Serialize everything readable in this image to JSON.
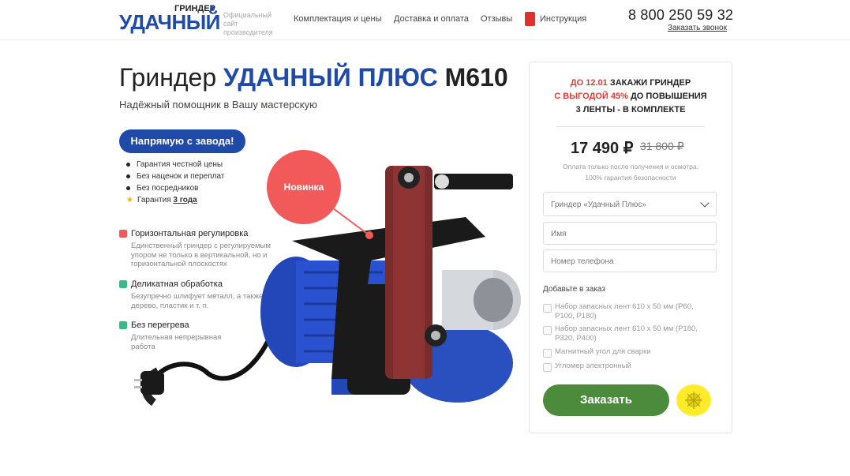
{
  "header": {
    "logo_top": "ГРИНДЕР",
    "logo_main": "УДАЧНЫЙ",
    "site_note": "Официальный сайт производителя",
    "nav": [
      "Комплектация и цены",
      "Доставка и оплата",
      "Отзывы",
      "Инструкция"
    ],
    "phone": "8 800 250 59 32",
    "callback": "Заказать звонок"
  },
  "hero": {
    "title_prefix": "Гриндер",
    "title_highlight": "УДАЧНЫЙ ПЛЮС",
    "title_model": "M610",
    "subtitle": "Надёжный помощник в Вашу мастерскую",
    "pill": "Напрямую с завода!",
    "bullets": [
      "Гарантия честной цены",
      "Без наценок и переплат",
      "Без посредников"
    ],
    "warranty_prefix": "Гарантия",
    "warranty_value": "3 года",
    "badge": "Новинка"
  },
  "features": [
    {
      "title": "Горизонтальная регулировка",
      "desc": "Единственный гриндер с регулируемым упором не только в вертикальной, но и горизонтальной плоскостях",
      "color": "#f25a5a"
    },
    {
      "title": "Деликатная обработка",
      "desc": "Безупречно шлифует металл, а также дерево, пластик и т. п.",
      "color": "#3ab98a"
    },
    {
      "title": "Без перегрева",
      "desc": "Длительная непрерывная работа",
      "color": "#3ab98a"
    }
  ],
  "order_card": {
    "promo_red1": "ДО 12.01",
    "promo_text1": "ЗАКАЖИ ГРИНДЕР",
    "promo_red2": "С ВЫГОДОЙ 45%",
    "promo_text2": "ДО ПОВЫШЕНИЯ",
    "promo_text3": "3 ЛЕНТЫ - В КОМПЛЕКТЕ",
    "price": "17 490 ₽",
    "old_price": "31 800 ₽",
    "note1": "Оплата только после получения и осмотра.",
    "note2": "100% гарантия безопасности",
    "select_value": "Гриндер «Удачный Плюс»",
    "name_placeholder": "Имя",
    "phone_placeholder": "Номер телефона",
    "add_title": "Добавьте в заказ",
    "options": [
      "Набор запасных лент 610 x 50 мм (P60, P100, P180)",
      "Набор запасных лент 610 x 50 мм (P180, P320, P400)",
      "Магнитный угол для сварки",
      "Угломер электронный"
    ],
    "order_button": "Заказать"
  },
  "colors": {
    "brand": "#1f4aa8",
    "accent_red": "#e53935",
    "order_green": "#4b8b3b",
    "yellow": "#ffeb2a"
  }
}
